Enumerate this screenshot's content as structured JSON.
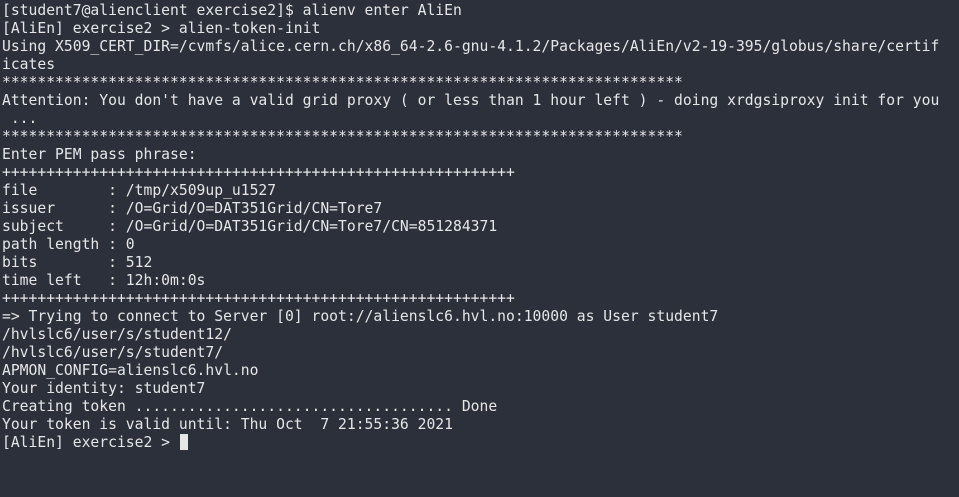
{
  "terminal": {
    "lines": [
      "[student7@alienclient exercise2]$ alienv enter AliEn",
      "[AliEn] exercise2 > alien-token-init",
      "Using X509_CERT_DIR=/cvmfs/alice.cern.ch/x86_64-2.6-gnu-4.1.2/Packages/AliEn/v2-19-395/globus/share/certif",
      "icates",
      "*****************************************************************************",
      "Attention: You don't have a valid grid proxy ( or less than 1 hour left ) - doing xrdgsiproxy init for you",
      " ...",
      "*****************************************************************************",
      "Enter PEM pass phrase:",
      "++++++++++++++++++++++++++++++++++++++++++++++++++++++++++",
      "file        : /tmp/x509up_u1527",
      "issuer      : /O=Grid/O=DAT351Grid/CN=Tore7",
      "subject     : /O=Grid/O=DAT351Grid/CN=Tore7/CN=851284371",
      "path length : 0",
      "bits        : 512",
      "time left   : 12h:0m:0s",
      "++++++++++++++++++++++++++++++++++++++++++++++++++++++++++",
      "=> Trying to connect to Server [0] root://alienslc6.hvl.no:10000 as User student7",
      "/hvlslc6/user/s/student12/",
      "/hvlslc6/user/s/student7/",
      "APMON_CONFIG=alienslc6.hvl.no",
      "Your identity: student7",
      "Creating token .................................... Done",
      "Your token is valid until: Thu Oct  7 21:55:36 2021"
    ],
    "prompt": "[AliEn] exercise2 > "
  },
  "colors": {
    "background": "#2b303b",
    "foreground": "#e6e6e6"
  }
}
